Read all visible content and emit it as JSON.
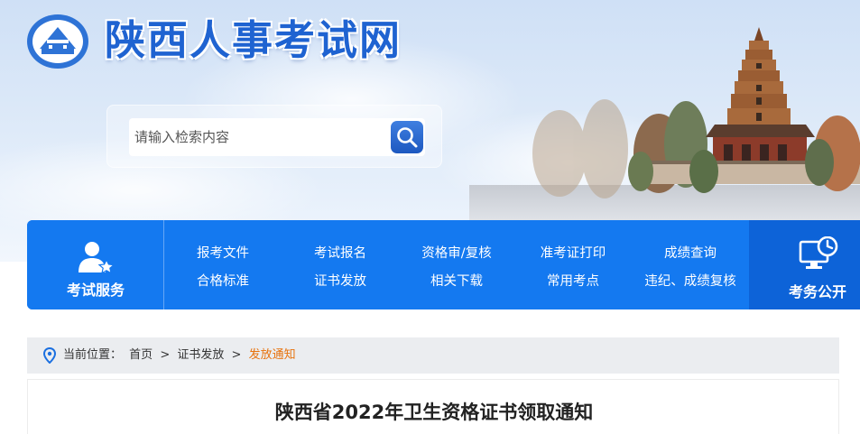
{
  "header": {
    "site_title": "陕西人事考试网"
  },
  "search": {
    "placeholder": "请输入检索内容"
  },
  "nav": {
    "left_label": "考试服务",
    "right_label": "考务公开",
    "links_row1": [
      "报考文件",
      "考试报名",
      "资格审/复核",
      "准考证打印",
      "成绩查询"
    ],
    "links_row2": [
      "合格标准",
      "证书发放",
      "相关下载",
      "常用考点",
      "违纪、成绩复核"
    ]
  },
  "breadcrumb": {
    "prefix": "当前位置：",
    "home": "首页",
    "sep1": ">",
    "section": "证书发放",
    "sep2": ">",
    "current": "发放通知"
  },
  "article": {
    "title": "陕西省2022年卫生资格证书领取通知"
  },
  "colors": {
    "nav_blue": "#1479f0",
    "nav_dark_blue": "#0d63d8",
    "title_blue": "#1f63d1",
    "breadcrumb_active": "#e8720c"
  }
}
